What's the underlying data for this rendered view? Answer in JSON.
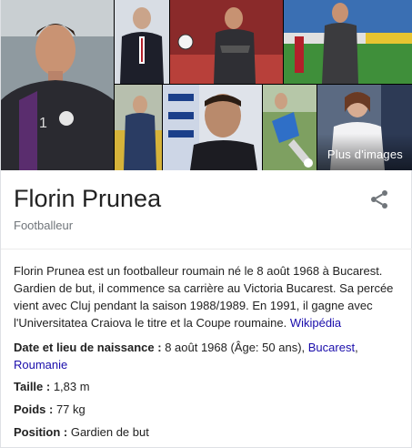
{
  "images": {
    "more_label": "Plus d'images"
  },
  "header": {
    "title": "Florin Prunea",
    "subtitle": "Footballeur"
  },
  "description": {
    "text": "Florin Prunea est un footballeur roumain né le 8 août 1968 à Bucarest. Gardien de but, il commence sa carrière au Victoria Bucarest. Sa percée vient avec Cluj pendant la saison 1988/1989. En 1991, il gagne avec l'Universitatea Craiova le titre et la Coupe roumaine.",
    "source_link": "Wikipédia"
  },
  "facts": {
    "birth": {
      "label": "Date et lieu de naissance :",
      "value": " 8 août 1968 (Âge: 50 ans), ",
      "link1": "Bucarest",
      "sep": ", ",
      "link2": "Roumanie"
    },
    "height": {
      "label": "Taille :",
      "value": " 1,83 m"
    },
    "weight": {
      "label": "Poids :",
      "value": " 77 kg"
    },
    "position": {
      "label": "Position :",
      "value": " Gardien de but"
    }
  },
  "colors": {
    "link": "#1a0dab",
    "subtitle": "#70757a",
    "divider": "#ebebeb"
  }
}
